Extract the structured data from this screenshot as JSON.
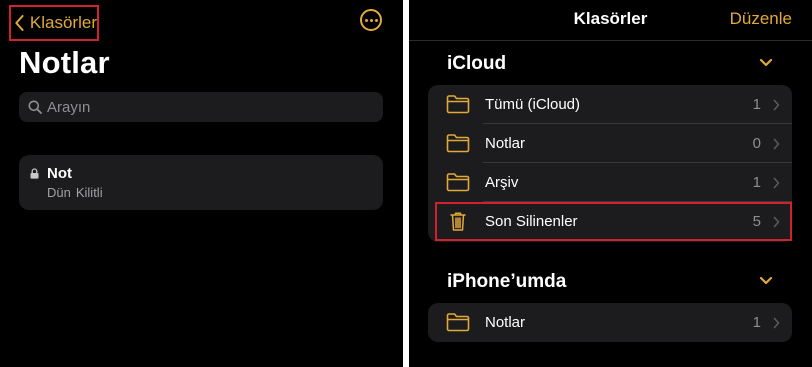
{
  "left": {
    "back_label": "Klasörler",
    "title": "Notlar",
    "search": {
      "placeholder": "Arayın"
    },
    "note": {
      "title": "Not",
      "date": "Dün",
      "status": "Kilitli"
    }
  },
  "right": {
    "nav_title": "Klasörler",
    "edit_label": "Düzenle",
    "sections": [
      {
        "title": "iCloud",
        "folders": [
          {
            "label": "Tümü (iCloud)",
            "count": "1",
            "icon": "folder-icon"
          },
          {
            "label": "Notlar",
            "count": "0",
            "icon": "folder-icon"
          },
          {
            "label": "Arşiv",
            "count": "1",
            "icon": "folder-icon"
          },
          {
            "label": "Son Silinenler",
            "count": "5",
            "icon": "trash-icon"
          }
        ]
      },
      {
        "title": "iPhone’umda",
        "folders": [
          {
            "label": "Notlar",
            "count": "1",
            "icon": "folder-icon"
          }
        ]
      }
    ]
  },
  "colors": {
    "accent": "#e2a93a",
    "highlight": "#d0212e",
    "background": "#000000",
    "card": "#1c1c1e"
  }
}
